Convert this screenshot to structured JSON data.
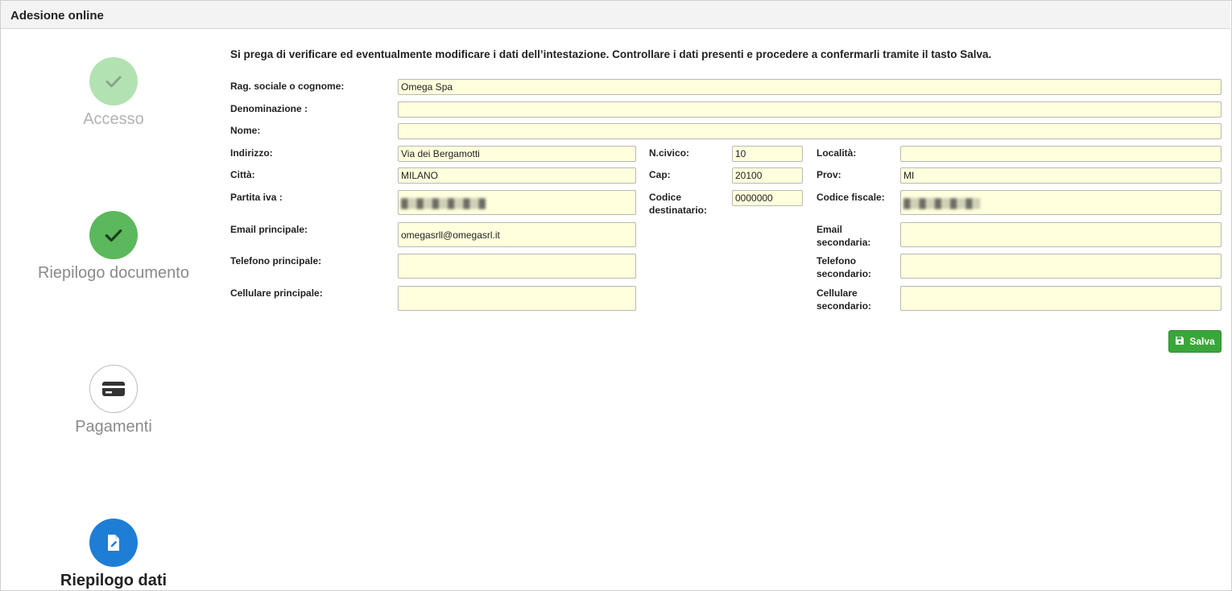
{
  "header": {
    "title": "Adesione online"
  },
  "steps": [
    {
      "label": "Accesso",
      "icon": "check-icon",
      "status": "done-faded"
    },
    {
      "label": "Riepilogo documento",
      "icon": "check-icon",
      "status": "done"
    },
    {
      "label": "Pagamenti",
      "icon": "credit-card-icon",
      "status": "pending"
    },
    {
      "label": "Riepilogo dati",
      "icon": "edit-document-icon",
      "status": "active"
    }
  ],
  "form": {
    "intro": "Si prega di verificare ed eventualmente modificare i dati dell’intestazione. Controllare i dati presenti e procedere a confermarli tramite il tasto Salva.",
    "rag_sociale": {
      "label": "Rag. sociale o cognome:",
      "value": "Omega Spa"
    },
    "denominazione": {
      "label": "Denominazione :",
      "value": ""
    },
    "nome": {
      "label": "Nome:",
      "value": ""
    },
    "indirizzo": {
      "label": "Indirizzo:",
      "value": "Via dei Bergamotti"
    },
    "ncivico": {
      "label": "N.civico:",
      "value": "10"
    },
    "localita": {
      "label": "Località:",
      "value": ""
    },
    "citta": {
      "label": "Città:",
      "value": "MILANO"
    },
    "cap": {
      "label": "Cap:",
      "value": "20100"
    },
    "prov": {
      "label": "Prov:",
      "value": "MI"
    },
    "partita_iva": {
      "label": "Partita iva :",
      "value": ""
    },
    "codice_destinatario": {
      "label_line1": "Codice",
      "label_line2": "destinatario:",
      "value": "0000000"
    },
    "codice_fiscale": {
      "label": "Codice fiscale:",
      "value": ""
    },
    "email_principale": {
      "label": "Email principale:",
      "value": "omegasrll@omegasrl.it"
    },
    "email_secondaria": {
      "label_line1": "Email",
      "label_line2": "secondaria:",
      "value": ""
    },
    "telefono_principale": {
      "label": "Telefono principale:",
      "value": ""
    },
    "telefono_secondario": {
      "label_line1": "Telefono",
      "label_line2": "secondario:",
      "value": ""
    },
    "cellulare_principale": {
      "label": "Cellulare principale:",
      "value": ""
    },
    "cellulare_secondario": {
      "label_line1": "Cellulare",
      "label_line2": "secondario:",
      "value": ""
    },
    "save_label": "Salva"
  },
  "colors": {
    "field_bg": "#ffffdd",
    "save_green": "#3aa63a",
    "step_done": "#5cb85c",
    "step_done_faded": "#b2e2b2",
    "step_active": "#1e7ed6"
  }
}
